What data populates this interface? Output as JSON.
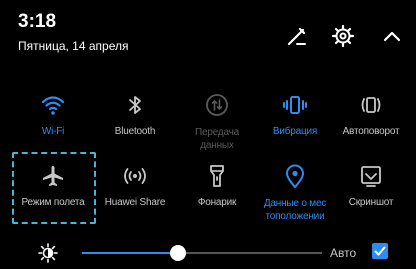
{
  "status": {
    "time": "3:18",
    "date": "Пятница, 14 апреля"
  },
  "header_icons": [
    "edit-icon",
    "gear-icon",
    "chevron-up-icon"
  ],
  "tiles": [
    {
      "label": "Wi-Fi",
      "icon": "wifi-icon",
      "state": "on"
    },
    {
      "label": "Bluetooth",
      "icon": "bluetooth-icon",
      "state": "off"
    },
    {
      "label": "Передача данных",
      "icon": "mobile-data-icon",
      "state": "disabled"
    },
    {
      "label": "Вибрация",
      "icon": "vibration-icon",
      "state": "on"
    },
    {
      "label": "Автоповорот",
      "icon": "auto-rotate-icon",
      "state": "off"
    },
    {
      "label": "Режим полета",
      "icon": "airplane-icon",
      "state": "off"
    },
    {
      "label": "Huawei Share",
      "icon": "huawei-share-icon",
      "state": "off"
    },
    {
      "label": "Фонарик",
      "icon": "flashlight-icon",
      "state": "off"
    },
    {
      "label": "Данные о мес тоположении",
      "icon": "location-icon",
      "state": "on"
    },
    {
      "label": "Скриншот",
      "icon": "screenshot-icon",
      "state": "off"
    }
  ],
  "brightness": {
    "level": 0.4,
    "auto_label": "Авто",
    "auto_checked": true
  },
  "colors": {
    "background": "#000000",
    "accent": "#2d8cf0",
    "text": "#ffffff",
    "label_off": "#c8c8c8",
    "label_disabled": "#5a5a5a",
    "highlight": "#4ab3d8"
  }
}
